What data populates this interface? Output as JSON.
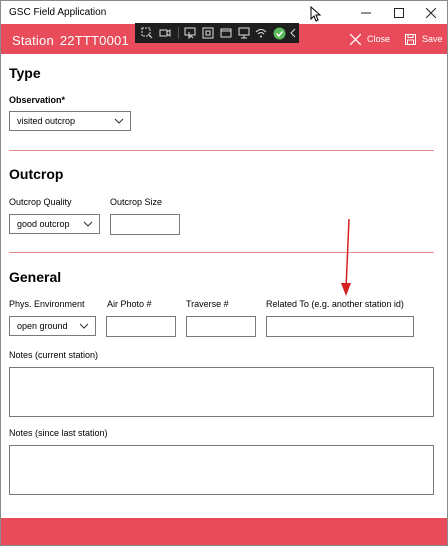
{
  "window": {
    "title": "GSC Field Application",
    "accent_color": "#e84c5a"
  },
  "appbar": {
    "station_label": "Station",
    "station_id": "22TTT0001",
    "close_label": "Close",
    "save_label": "Save"
  },
  "toolbar": {
    "icons": [
      "select-icon",
      "video-icon",
      "pointer-icon",
      "frame-icon",
      "window-icon",
      "screen-icon",
      "wifi-icon",
      "check-icon",
      "chevron-left-icon"
    ]
  },
  "type_section": {
    "title": "Type",
    "observation_label": "Observation*",
    "observation_value": "visited outcrop"
  },
  "outcrop_section": {
    "title": "Outcrop",
    "quality_label": "Outcrop Quality",
    "quality_value": "good outcrop",
    "size_label": "Outcrop Size",
    "size_value": ""
  },
  "general_section": {
    "title": "General",
    "phys_env_label": "Phys. Environment",
    "phys_env_value": "open ground",
    "air_photo_label": "Air Photo #",
    "air_photo_value": "",
    "traverse_label": "Traverse #",
    "traverse_value": "",
    "related_label": "Related To (e.g. another station id)",
    "related_value": "",
    "notes_current_label": "Notes (current station)",
    "notes_current_value": "",
    "notes_since_label": "Notes (since last station)",
    "notes_since_value": ""
  }
}
